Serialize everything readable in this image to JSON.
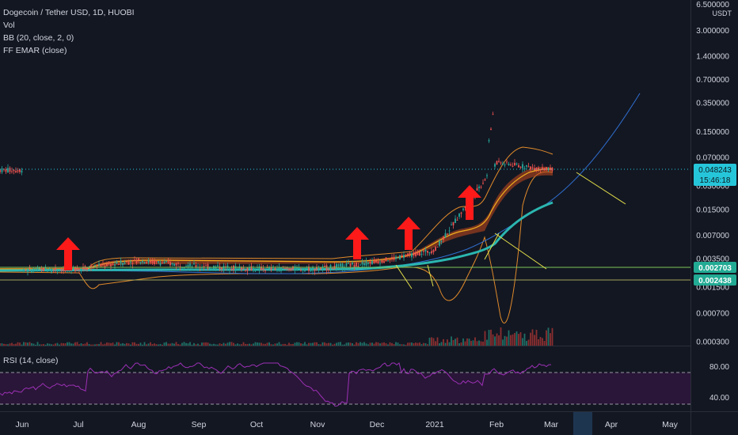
{
  "legend": {
    "symbol": "Dogecoin / Tether USD, 1D, HUOBI",
    "volume": "Vol",
    "bb": "BB (20, close, 2, 0)",
    "ema": "FF EMAR (close)"
  },
  "rsi": {
    "label": "RSI (14, close)",
    "levels": [
      "80.00",
      "40.00"
    ]
  },
  "price_axis": {
    "unit": "USDT",
    "ticks": [
      "6.500000",
      "3.000000",
      "1.400000",
      "0.700000",
      "0.350000",
      "0.150000",
      "0.070000",
      "0.030000",
      "0.015000",
      "0.007000",
      "0.003500",
      "0.001500",
      "0.000700",
      "0.000300"
    ],
    "current_price": "0.048243",
    "countdown": "15:46:18",
    "level_1": "0.002703",
    "level_2": "0.002438"
  },
  "time_axis": {
    "labels": [
      "Jun",
      "Jul",
      "Aug",
      "Sep",
      "Oct",
      "Nov",
      "Dec",
      "2021",
      "Feb",
      "Mar",
      "Apr",
      "May"
    ]
  },
  "colors": {
    "background": "#131722",
    "up_arrow": "#ff1a1a",
    "price_tag": "#22ab94",
    "current_tag": "#26c6da",
    "ema_teal": "#2bb6b0",
    "bb_orange": "#e08a2a",
    "projection": "#2f6fd0",
    "annotation": "#e6e24a",
    "rsi_line": "#9b30b5",
    "rsi_band": "#2a1638"
  },
  "chart_data": {
    "type": "line",
    "log_scale": true,
    "ylim": [
      0.0002,
      6.5
    ],
    "x": [
      "Jun",
      "Jul",
      "Aug",
      "Sep",
      "Oct",
      "Nov",
      "Dec",
      "2021",
      "Feb",
      "Mar"
    ],
    "series": [
      {
        "values": [
          0.0025,
          0.0026,
          0.0033,
          0.0028,
          0.0026,
          0.0026,
          0.0032,
          0.0045,
          0.06,
          0.048
        ]
      }
    ],
    "horizontal_lines": [
      0.048243,
      0.002703,
      0.002438
    ],
    "rsi": {
      "upper": 80,
      "lower": 40
    },
    "annotations": [
      "up-arrow Jul",
      "up-arrow Nov",
      "up-arrow Dec",
      "up-arrow Jan",
      "arrow Mar"
    ]
  }
}
